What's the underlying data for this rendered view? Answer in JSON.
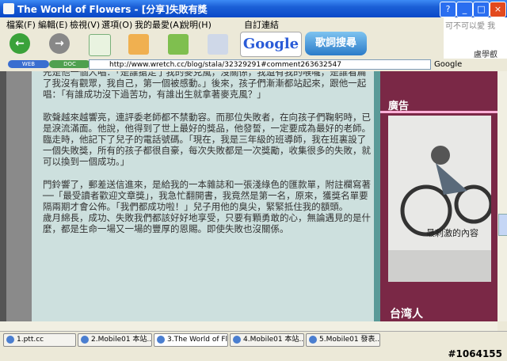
{
  "window": {
    "title": "The World of Flowers - [分享]失敗有獎",
    "buttons": {
      "help": "?",
      "minimize": "_",
      "maximize": "□",
      "close": "×"
    }
  },
  "menu": [
    "檔案(F)",
    "編輯(E)",
    "檢視(V)",
    "選項(O)",
    "我的最愛(A)",
    "說明(H)",
    "自訂連結"
  ],
  "toolbar": {
    "google_label": "Google",
    "lyrics_label": "歌詞搜尋",
    "ad_text": "可不可以愛 我",
    "ad_name": "盧學叡"
  },
  "addressbar": {
    "pill_left": "WEB",
    "pill_right": "DOC",
    "url": "http://www.wretch.cc/blog/stala/32329291#comment263632547",
    "search_engine": "Google"
  },
  "article": {
    "paragraphs": [
      "先是他一個人唱：「是誰搶走了我的麥克風，沒關係，我還有我的喉嚨，是誰看扁了我沒有觀眾，我自己，第一個被感動。」後來，孩子們漸漸都站起來，跟他一起唱：「有誰成功沒下過苦功，有誰出生就拿著麥克風？」",
      "",
      "歌聲越來越響亮，連評委老師都不禁動容。而那位失敗者，在向孩子們鞠躬時，已是淚流滿面。他說，他得到了世上最好的獎品，他發誓，一定要成為最好的老師。臨走時，他記下了兒子的電話號碼。「現在，我是三年級的班導師，我在班裏設了一個失敗獎，所有的孩子都很自豪，每次失敗都是一次獎勵，收集很多的失敗，就可以換到一個成功。」",
      "",
      "門鈴響了，郵差送信進來，是給我的一本雜誌和一張淺綠色的匯款單，附註欄寫著",
      "──「最受讀者歡迎文章獎」，我急忙翻開書，我竟然是第一名，原來，獲獎名單要隔兩期才會公佈。「我們都成功啦！」兒子用他的臭尖，緊緊抵住我的額頭。",
      "歲月綿長，成功、失敗我們都該好好地享受，只要有顆勇敢的心，無論遇見的是什麼，都是生命一場又一場的豐厚的恩賜。即使失敗也沒關係。"
    ]
  },
  "sidebar": {
    "header": "廣告",
    "ad_caption": "最刺激的內容",
    "footer": "台湾人"
  },
  "tasks": [
    {
      "label": "1.ptt.cc"
    },
    {
      "label": "2.Mobile01 本站..."
    },
    {
      "label": "3.The World of Fl..."
    },
    {
      "label": "4.Mobile01 本站..."
    },
    {
      "label": "5.Mobile01 發表..."
    }
  ],
  "status": {
    "post_id": "#1064155"
  },
  "colors": {
    "article_bg": "#cde0de",
    "sidebar_bg": "#7a2846",
    "titlebar": "#0a48c8"
  }
}
